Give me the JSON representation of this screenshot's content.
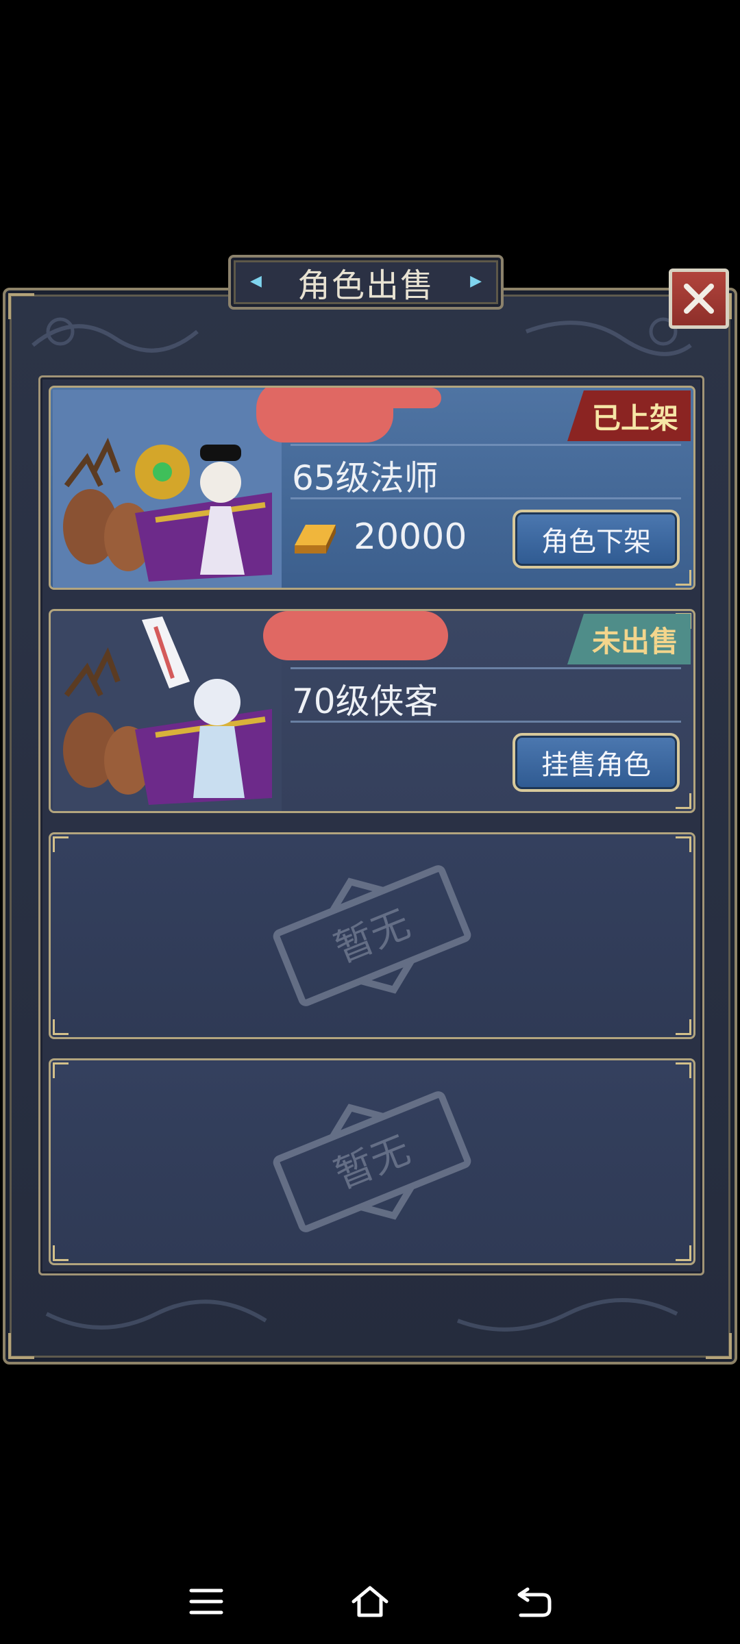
{
  "dialog": {
    "title": "角色出售"
  },
  "roles": [
    {
      "level_class": "65级法师",
      "status": "已上架",
      "price": "20000",
      "action_label": "角色下架"
    },
    {
      "level_class": "70级侠客",
      "status": "未出售",
      "action_label": "挂售角色"
    }
  ],
  "empty_slots": [
    {
      "stamp_text": "暂无"
    },
    {
      "stamp_text": "暂无"
    }
  ],
  "nav": {
    "menu_icon": "menu-icon",
    "home_icon": "home-icon",
    "back_icon": "back-icon"
  },
  "colors": {
    "listed_badge": "#8b2422",
    "unsold_badge": "#4f8d89",
    "redaction": "#e06863",
    "gold_frame": "#b3a57e"
  }
}
